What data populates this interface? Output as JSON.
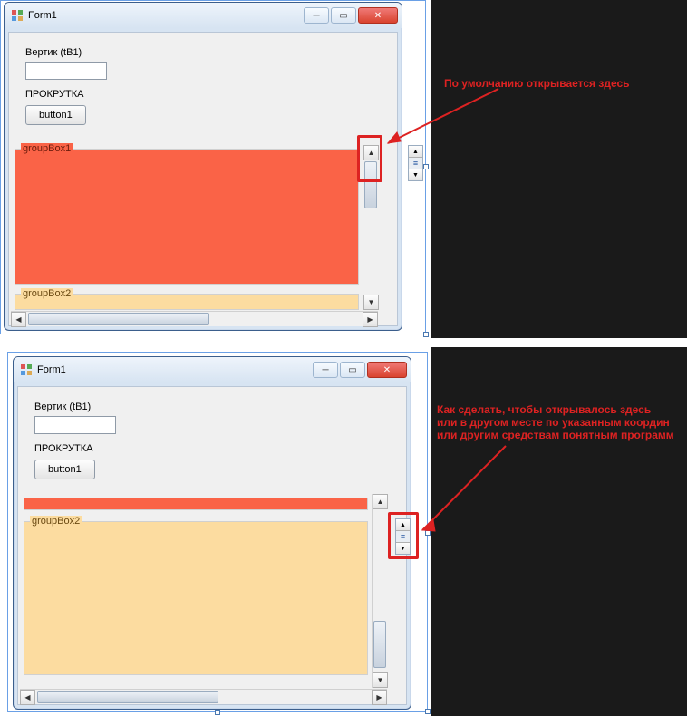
{
  "top": {
    "window": {
      "title": "Form1",
      "label_vertik": "Вертик (tB1)",
      "label_scroll": "ПРОКРУТКА",
      "button1": "button1",
      "groupbox1_title": "groupBox1",
      "groupbox2_title": "groupBox2"
    },
    "annotation": "По умолчанию открывается здесь"
  },
  "bottom": {
    "window": {
      "title": "Form1",
      "label_vertik": "Вертик (tB1)",
      "label_scroll": "ПРОКРУТКА",
      "button1": "button1",
      "groupbox2_title": "groupBox2"
    },
    "annotation_line1": "Как сделать, чтобы открывалось здесь",
    "annotation_line2": "или в другом месте по указанным координ",
    "annotation_line3": "или другим средствам понятным программ"
  }
}
